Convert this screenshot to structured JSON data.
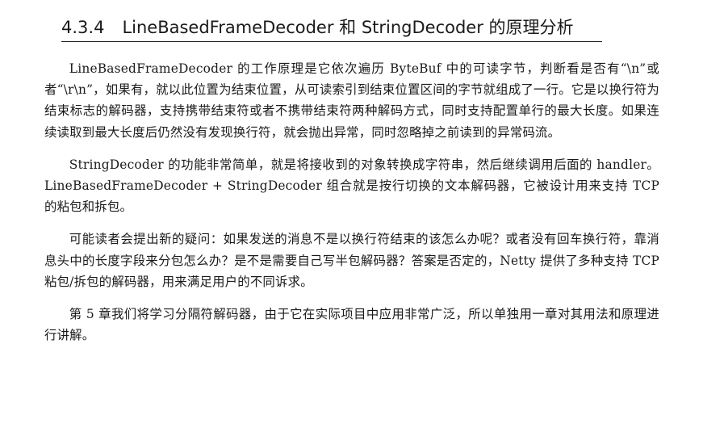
{
  "section": {
    "number": "4.3.4",
    "title": "LineBasedFrameDecoder 和 StringDecoder 的原理分析"
  },
  "paragraphs": [
    "LineBasedFrameDecoder 的工作原理是它依次遍历 ByteBuf 中的可读字节，判断看是否有“\\n”或者“\\r\\n”，如果有，就以此位置为结束位置，从可读索引到结束位置区间的字节就组成了一行。它是以换行符为结束标志的解码器，支持携带结束符或者不携带结束符两种解码方式，同时支持配置单行的最大长度。如果连续读取到最大长度后仍然没有发现换行符，就会抛出异常，同时忽略掉之前读到的异常码流。",
    "StringDecoder 的功能非常简单，就是将接收到的对象转换成字符串，然后继续调用后面的 handler。LineBasedFrameDecoder + StringDecoder 组合就是按行切换的文本解码器，它被设计用来支持 TCP 的粘包和拆包。",
    "可能读者会提出新的疑问：如果发送的消息不是以换行符结束的该怎么办呢？或者没有回车换行符，靠消息头中的长度字段来分包怎么办？是不是需要自己写半包解码器？答案是否定的，Netty 提供了多种支持 TCP 粘包/拆包的解码器，用来满足用户的不同诉求。",
    "第 5 章我们将学习分隔符解码器，由于它在实际项目中应用非常广泛，所以单独用一章对其用法和原理进行讲解。"
  ]
}
